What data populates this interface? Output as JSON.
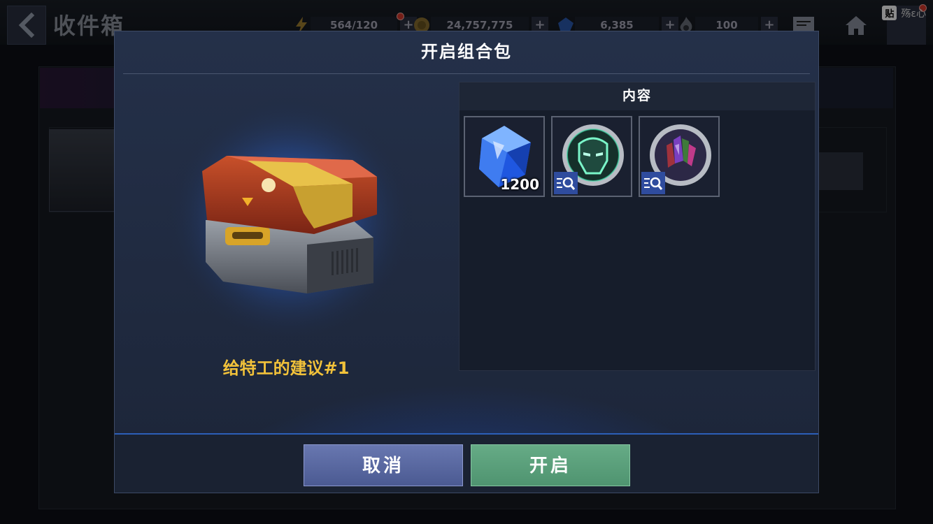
{
  "header": {
    "title": "收件箱",
    "resources": [
      {
        "icon": "lightning-energy-icon",
        "value": "564/120"
      },
      {
        "icon": "gold-coin-icon",
        "value": "24,757,775"
      },
      {
        "icon": "blue-crystal-icon",
        "value": "6,385"
      },
      {
        "icon": "dark-flame-icon",
        "value": "100"
      }
    ],
    "plus_label": "+",
    "overlay": {
      "tag": "贴",
      "text": "殇ε心"
    }
  },
  "modal": {
    "title": "开启组合包",
    "item_name": "给特工的建议#1",
    "contents": {
      "header": "内容",
      "items": [
        {
          "icon": "blue-crystal-icon",
          "quantity": "1200"
        },
        {
          "icon": "iron-man-helmet-icon"
        },
        {
          "icon": "multicolor-crystals-icon"
        }
      ]
    },
    "buttons": {
      "cancel": "取消",
      "open": "开启"
    }
  },
  "colors": {
    "accent_gold": "#f2c23a",
    "cancel": "#5866a0",
    "open": "#5aa07a"
  }
}
